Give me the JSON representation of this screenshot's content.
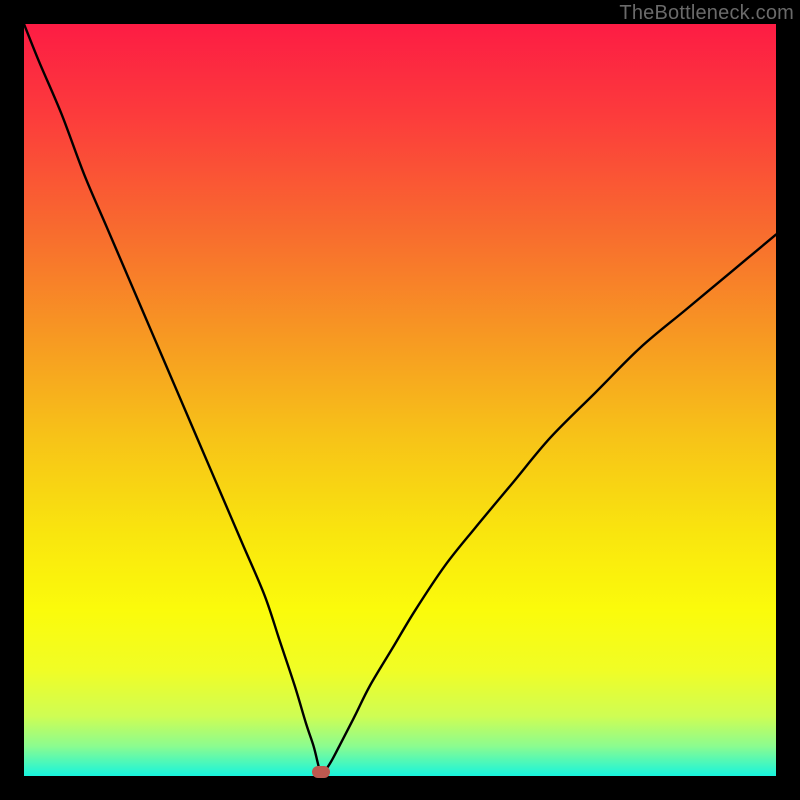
{
  "watermark": "TheBottleneck.com",
  "colors": {
    "gradient_stops": [
      {
        "offset": 0.0,
        "color": "#fd1c44"
      },
      {
        "offset": 0.12,
        "color": "#fc3b3c"
      },
      {
        "offset": 0.28,
        "color": "#f86d2e"
      },
      {
        "offset": 0.42,
        "color": "#f79a22"
      },
      {
        "offset": 0.55,
        "color": "#f7c318"
      },
      {
        "offset": 0.68,
        "color": "#f9e60e"
      },
      {
        "offset": 0.78,
        "color": "#fbfb0b"
      },
      {
        "offset": 0.86,
        "color": "#f0fd26"
      },
      {
        "offset": 0.92,
        "color": "#cffd53"
      },
      {
        "offset": 0.96,
        "color": "#8cfc8f"
      },
      {
        "offset": 1.0,
        "color": "#17f4de"
      }
    ],
    "frame": "#000000",
    "curve": "#000000",
    "marker": "#bd584f"
  },
  "chart_data": {
    "type": "line",
    "title": "",
    "xlabel": "",
    "ylabel": "",
    "xlim": [
      0,
      100
    ],
    "ylim": [
      0,
      100
    ],
    "grid": false,
    "series": [
      {
        "name": "bottleneck-curve",
        "x": [
          0,
          2,
          5,
          8,
          11,
          14,
          17,
          20,
          23,
          26,
          29,
          32,
          34,
          36,
          37.5,
          38.5,
          39,
          39.3,
          39.5,
          39.8,
          40.2,
          41,
          42.2,
          44,
          46,
          49,
          52,
          56,
          60,
          65,
          70,
          76,
          82,
          88,
          94,
          100
        ],
        "y": [
          100,
          95,
          88,
          80,
          73,
          66,
          59,
          52,
          45,
          38,
          31,
          24,
          18,
          12,
          7,
          4,
          2,
          0.8,
          0.2,
          0.3,
          0.9,
          2.2,
          4.5,
          8,
          12,
          17,
          22,
          28,
          33,
          39,
          45,
          51,
          57,
          62,
          67,
          72
        ]
      }
    ],
    "marker": {
      "x": 39.5,
      "y": 0.5
    }
  }
}
